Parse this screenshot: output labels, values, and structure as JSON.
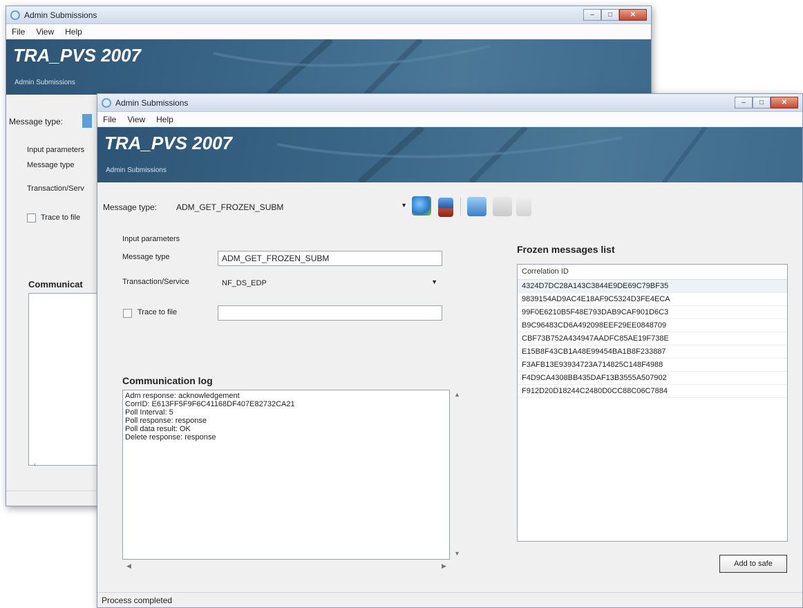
{
  "window": {
    "title": "Admin Submissions",
    "minimize": "–",
    "maximize": "□",
    "close": "✕"
  },
  "menu": [
    "File",
    "View",
    "Help"
  ],
  "banner": {
    "title": "TRA_PVS 2007",
    "subtitle": "Admin Submissions"
  },
  "back_window": {
    "message_type_label": "Message type:",
    "input_parameters": "Input parameters",
    "message_type": "Message type",
    "transaction_service": "Transaction/Serv",
    "trace_to_file": "Trace to file",
    "communication": "Communicat"
  },
  "front_window": {
    "message_type_label": "Message type:",
    "message_type_value": "ADM_GET_FROZEN_SUBM",
    "input_parameters_label": "Input parameters",
    "message_type_field_label": "Message type",
    "message_type_field_value": "ADM_GET_FROZEN_SUBM",
    "transaction_service_label": "Transaction/Service",
    "transaction_service_value": "NF_DS_EDP",
    "trace_to_file_label": "Trace to file",
    "trace_to_file_value": "",
    "communication_log_title": "Communication log",
    "communication_log": [
      "Adm response: acknowledgement",
      "CorrID: E613FF5F9F6C41168DF407E82732CA21",
      "Poll Interval: 5",
      "Poll response: response",
      "Poll data result: OK",
      "Delete response: response"
    ],
    "frozen_title": "Frozen messages list",
    "frozen_column": "Correlation ID",
    "frozen_rows": [
      "4324D7DC28A143C3844E9DE69C79BF35",
      "9839154AD9AC4E18AF9C5324D3FE4ECA",
      "99F0E6210B5F48E793DAB9CAF901D6C3",
      "B9C96483CD6A492098EEF29EE0848709",
      "CBF73B752A434947AADFC85AE19F738E",
      "E15B8F43CB1A48E99454BA1B8F233887",
      "F3AFB13E93934723A714825C148F4988",
      "F4D9CA4308BB435DAF13B3555A507902",
      "F912D20D18244C2480D0CC88C06C7884"
    ],
    "add_to_safe": "Add to safe",
    "status": "Process completed"
  },
  "colors": {
    "banner": "#3b6888",
    "accent": "#6a9fd4"
  }
}
